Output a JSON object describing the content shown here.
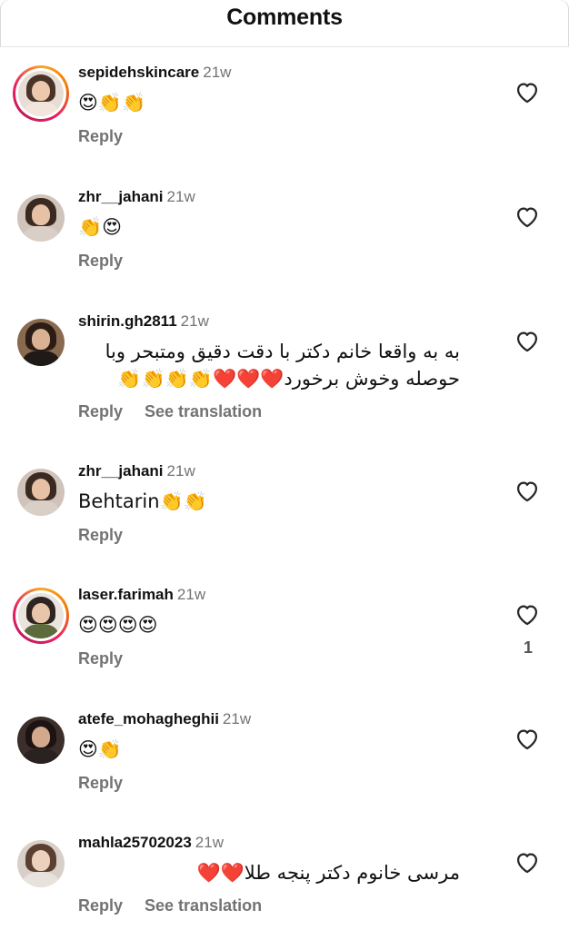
{
  "header": {
    "title": "Comments"
  },
  "comments": [
    {
      "username": "sepidehskincare",
      "time": "21w",
      "text": "😍👏👏",
      "rtl": false,
      "actions": [
        "Reply"
      ],
      "likes": "",
      "avatar": {
        "ring": true,
        "hair": "#4a3428",
        "body": "#f2e6dc",
        "bg": "#e8ddd5",
        "face": "#ecc9ae"
      }
    },
    {
      "username": "zhr__jahani",
      "time": "21w",
      "text": "👏😍",
      "rtl": false,
      "actions": [
        "Reply"
      ],
      "likes": "",
      "avatar": {
        "ring": false,
        "hair": "#3a2a22",
        "body": "#d9cfc7",
        "bg": "#cfc3ba",
        "face": "#e6c1a5"
      }
    },
    {
      "username": "shirin.gh2811",
      "time": "21w",
      "text": "به به واقعا خانم دکتر با دقت دقیق ومتبحر وبا حوصله وخوش برخورد❤️❤️❤️👏👏👏👏",
      "rtl": true,
      "actions": [
        "Reply",
        "See translation"
      ],
      "likes": "",
      "avatar": {
        "ring": false,
        "hair": "#2b1d16",
        "body": "#1f1a18",
        "bg": "#8a6a4e",
        "face": "#d9b294"
      }
    },
    {
      "username": "zhr__jahani",
      "time": "21w",
      "text": "Behtarin👏👏",
      "rtl": false,
      "actions": [
        "Reply"
      ],
      "likes": "",
      "avatar": {
        "ring": false,
        "hair": "#3a2a22",
        "body": "#d9cfc7",
        "bg": "#cfc3ba",
        "face": "#e6c1a5"
      }
    },
    {
      "username": "laser.farimah",
      "time": "21w",
      "text": "😍😍😍😍",
      "rtl": false,
      "actions": [
        "Reply"
      ],
      "likes": "1",
      "avatar": {
        "ring": true,
        "hair": "#2e2420",
        "body": "#5d6b3c",
        "bg": "#e9e4de",
        "face": "#e8c6aa"
      }
    },
    {
      "username": "atefe_mohagheghii",
      "time": "21w",
      "text": "😍👏",
      "rtl": false,
      "actions": [
        "Reply"
      ],
      "likes": "",
      "avatar": {
        "ring": false,
        "hair": "#1c1412",
        "body": "#2a2220",
        "bg": "#3c2f2b",
        "face": "#d2a98c"
      }
    },
    {
      "username": "mahla25702023",
      "time": "21w",
      "text": "مرسی خانوم دکتر پنجه طلا❤️❤️",
      "rtl": true,
      "actions": [
        "Reply",
        "See translation"
      ],
      "likes": "",
      "avatar": {
        "ring": false,
        "hair": "#5b4032",
        "body": "#e8e2dc",
        "bg": "#d8d0c8",
        "face": "#ecd2bd"
      }
    }
  ],
  "icons": {
    "like": "heart-outline-icon"
  },
  "colors": {
    "muted": "#737373",
    "ring_start": "#f9a825",
    "ring_end": "#e91e63"
  }
}
